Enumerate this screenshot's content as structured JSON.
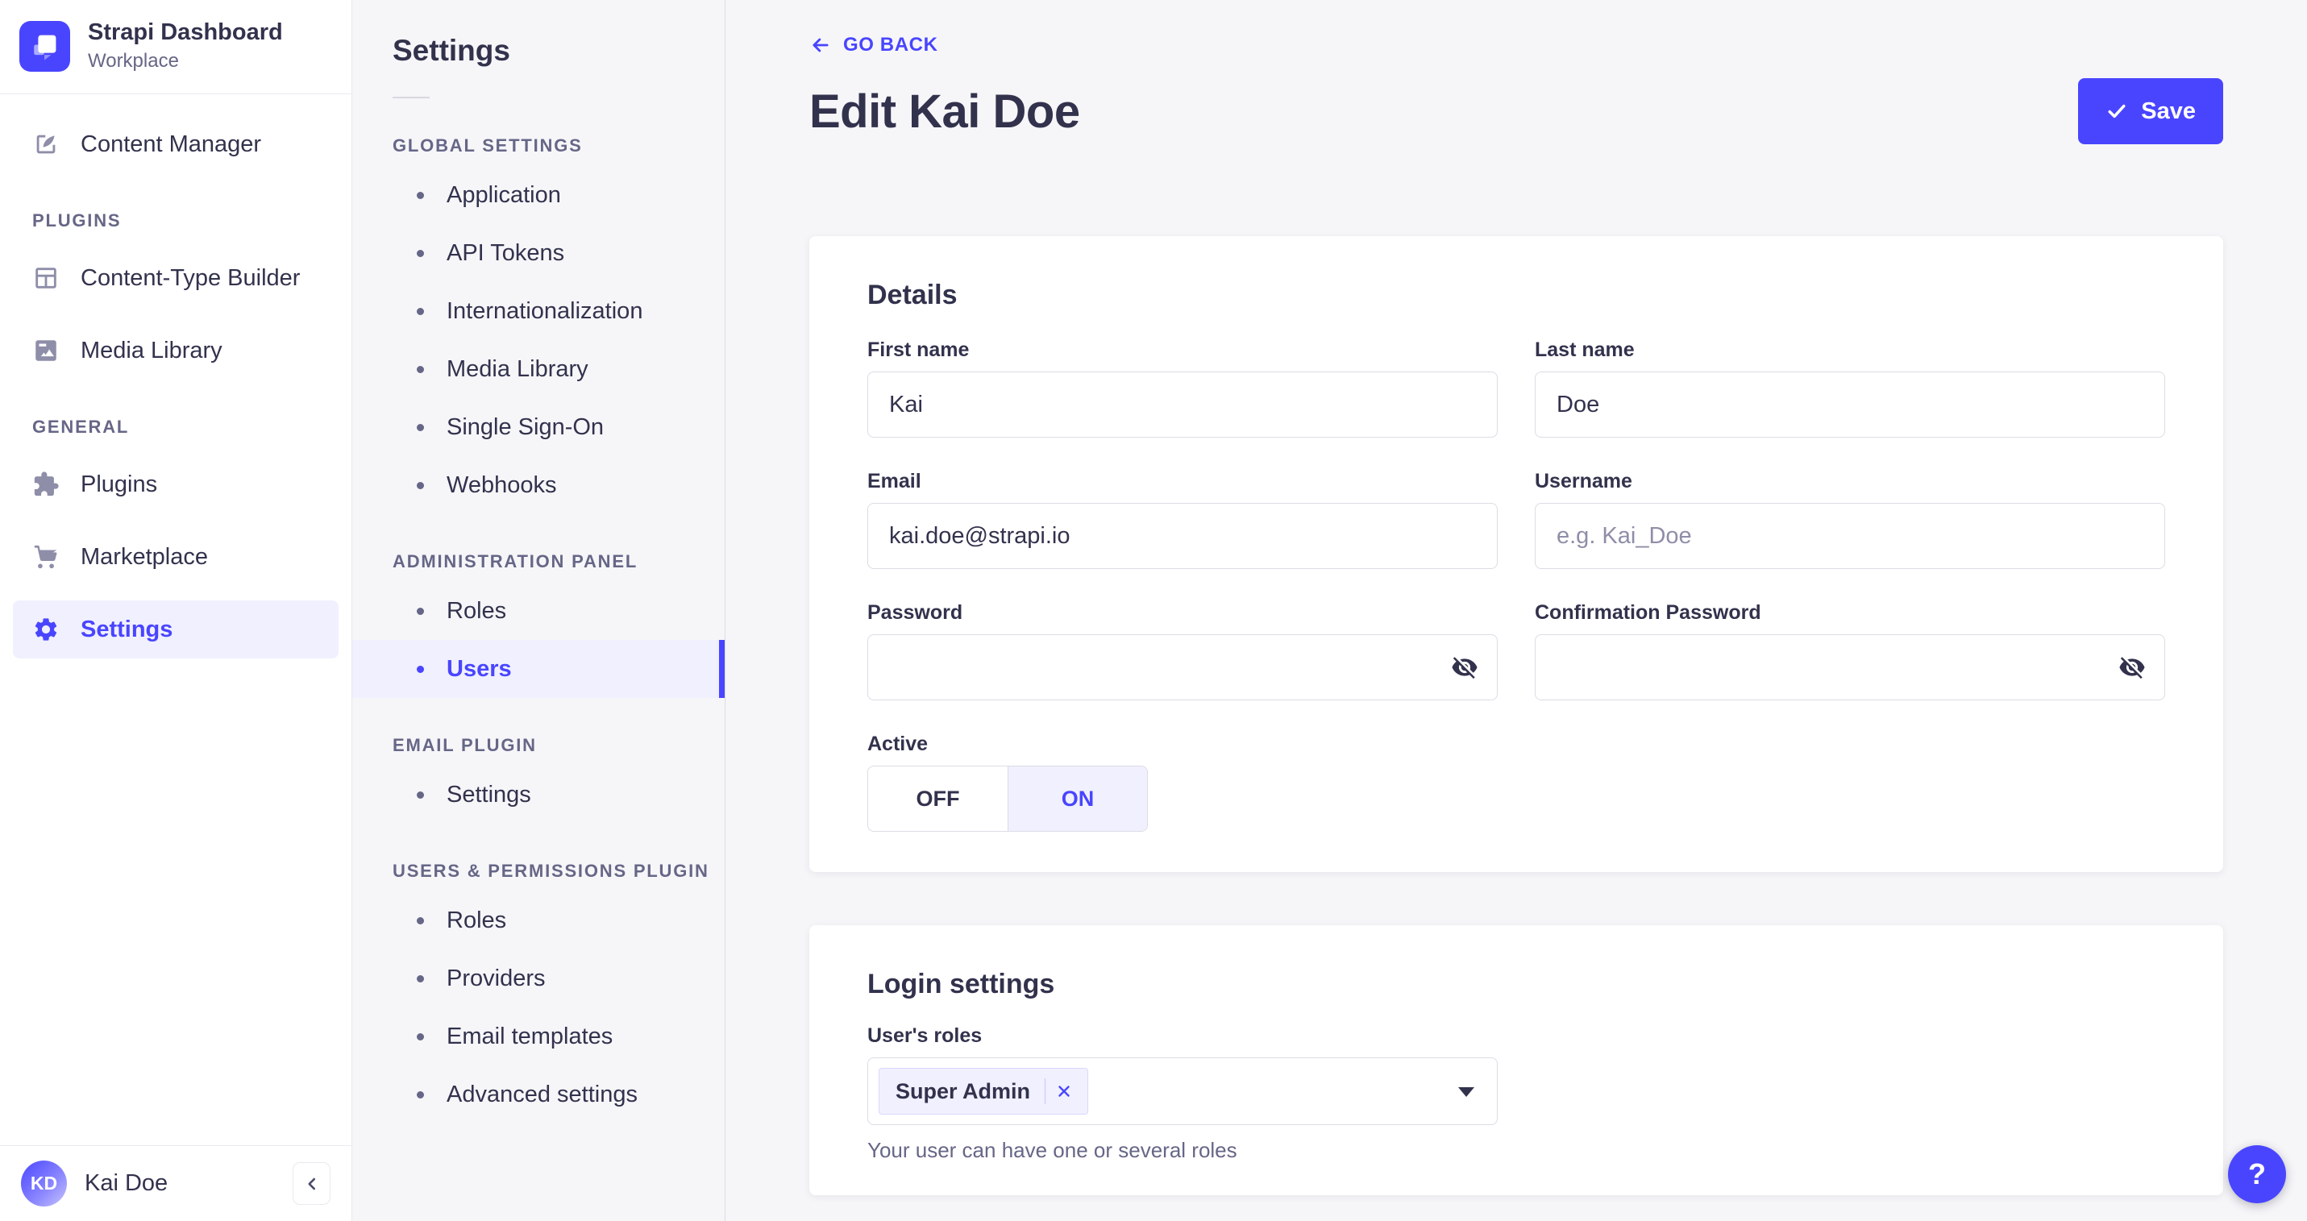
{
  "brand": {
    "title": "Strapi Dashboard",
    "subtitle": "Workplace"
  },
  "main_nav": {
    "content_manager": {
      "label": "Content Manager"
    },
    "plugins_section": {
      "label": "PLUGINS",
      "items": [
        {
          "label": "Content-Type Builder"
        },
        {
          "label": "Media Library"
        }
      ]
    },
    "general_section": {
      "label": "GENERAL",
      "items": [
        {
          "label": "Plugins"
        },
        {
          "label": "Marketplace"
        },
        {
          "label": "Settings"
        }
      ]
    },
    "user": {
      "initials": "KD",
      "name": "Kai Doe"
    }
  },
  "subnav": {
    "title": "Settings",
    "global": {
      "label": "GLOBAL SETTINGS",
      "items": [
        "Application",
        "API Tokens",
        "Internationalization",
        "Media Library",
        "Single Sign-On",
        "Webhooks"
      ]
    },
    "admin": {
      "label": "ADMINISTRATION PANEL",
      "items": [
        "Roles",
        "Users"
      ],
      "selected_item": "Users"
    },
    "email": {
      "label": "EMAIL PLUGIN",
      "items": [
        "Settings"
      ]
    },
    "users_permissions": {
      "label": "USERS & PERMISSIONS PLUGIN",
      "items": [
        "Roles",
        "Providers",
        "Email templates",
        "Advanced settings"
      ]
    }
  },
  "header": {
    "back_label": "GO BACK",
    "title": "Edit Kai Doe",
    "save_label": "Save"
  },
  "details": {
    "heading": "Details",
    "first_name": {
      "label": "First name",
      "value": "Kai"
    },
    "last_name": {
      "label": "Last name",
      "value": "Doe"
    },
    "email": {
      "label": "Email",
      "value": "kai.doe@strapi.io"
    },
    "username": {
      "label": "Username",
      "value": "",
      "placeholder": "e.g. Kai_Doe"
    },
    "password": {
      "label": "Password",
      "value": ""
    },
    "confirmation_password": {
      "label": "Confirmation Password",
      "value": ""
    },
    "active": {
      "label": "Active",
      "off_label": "OFF",
      "on_label": "ON",
      "value": "ON"
    }
  },
  "login": {
    "heading": "Login settings",
    "roles_label": "User's roles",
    "tag": "Super Admin",
    "helper": "Your user can have one or several roles"
  },
  "help": {
    "label": "?"
  },
  "colors": {
    "primary": "#4945ff",
    "primary_light_bg": "#f0f0ff",
    "text": "#32324d",
    "muted_text": "#666687",
    "placeholder": "#8e8ea9",
    "border": "#dcdce4",
    "background": "#f6f6f9"
  }
}
